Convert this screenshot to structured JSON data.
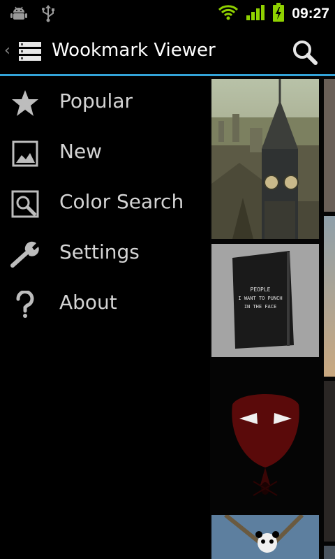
{
  "status_bar": {
    "time": "09:27",
    "icons": [
      "android-debug-icon",
      "usb-icon",
      "wifi-icon",
      "signal-icon",
      "battery-charging-icon"
    ]
  },
  "action_bar": {
    "title": "Wookmark Viewer",
    "up_icon": "chevron-left-icon",
    "app_icon": "list-menu-icon",
    "search_icon": "search-icon"
  },
  "drawer": {
    "items": [
      {
        "label": "Popular",
        "icon": "star-icon"
      },
      {
        "label": "New",
        "icon": "image-icon"
      },
      {
        "label": "Color Search",
        "icon": "color-search-icon"
      },
      {
        "label": "Settings",
        "icon": "wrench-icon"
      },
      {
        "label": "About",
        "icon": "question-icon"
      }
    ]
  },
  "grid": {
    "tiles": [
      {
        "subject": "big-ben-cityscape"
      },
      {
        "subject": "notebook-photo",
        "text": "PEOPLE\nI WANT TO PUNCH\nIN THE FACE"
      },
      {
        "subject": "spiderman-mask-dark"
      },
      {
        "subject": "panda-on-branch"
      },
      {
        "subject": "partial-dark-image"
      },
      {
        "subject": "partial-sky-clouds"
      },
      {
        "subject": "partial-dark-image-2"
      },
      {
        "subject": "partial-dark-image-3"
      }
    ]
  },
  "colors": {
    "accent": "#33a3d8",
    "background": "#000000",
    "signal_green": "#8fd100"
  }
}
